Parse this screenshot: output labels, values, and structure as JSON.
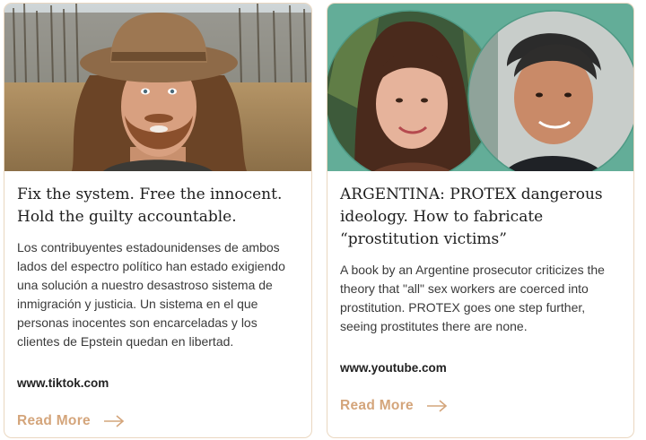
{
  "cards": [
    {
      "title": "Fix the system. Free the innocent. Hold the guilty accountable.",
      "description": "Los contribuyentes estadounidenses de ambos lados del espectro político han estado exigiendo una solución a nuestro desastroso sistema de inmigración y justicia. Un sistema en el que personas inocentes son encarceladas y los clientes de Epstein quedan en libertad.",
      "source": "www.tiktok.com",
      "cta": "Read More"
    },
    {
      "title": "ARGENTINA: PROTEX dangerous ideology. How to fabricate “prostitution victims”",
      "description": "A book by an Argentine prosecutor criticizes the theory that \"all\" sex workers are coerced into prostitution. PROTEX goes one step further, seeing prostitutes there are none.",
      "source": "www.youtube.com",
      "cta": "Read More"
    }
  ],
  "colors": {
    "accent": "#d4a57b",
    "card_border": "#ead7c0",
    "teal_background": "#63ad98"
  }
}
